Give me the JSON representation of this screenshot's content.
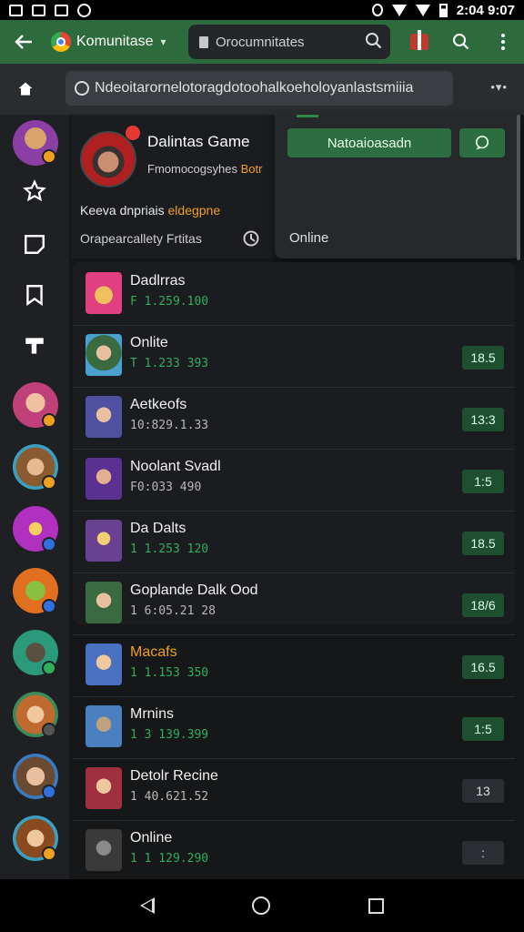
{
  "status_bar": {
    "time": "2:04 9:07"
  },
  "toolbar": {
    "tab_title": "Komunitase",
    "url_title": "Orocumnitates"
  },
  "address": {
    "text": "Ndeoitarornelotoragdotoohalkoeholoyanlastsmiiia",
    "more": "•▾•"
  },
  "profile": {
    "name": "Dalintas Game",
    "sub_prefix": "Fmomocogsyhes ",
    "sub_highlight": "Botr",
    "line_prefix": "Keeva dnpriais ",
    "line_highlight": "eldegpne",
    "line2": "Orapearcallety Frtitas"
  },
  "popup": {
    "primary_button": "Natoaioasadn",
    "status": "Online"
  },
  "list": {
    "items": [
      {
        "title": "Dadlrras",
        "sub": "F 1.259.100",
        "badge": ""
      },
      {
        "title": "Onlite",
        "sub": "T 1.233 393",
        "badge": "18.5"
      },
      {
        "title": "Aetkeofs",
        "sub": "10:829.1.33",
        "badge": "13:3"
      },
      {
        "title": "Noolant Svadl",
        "sub": "F0:033 490",
        "badge": "1:5"
      },
      {
        "title": "Da Dalts",
        "sub": "1 1.253 120",
        "badge": "18.5"
      },
      {
        "title": "Goplande Dalk Ood",
        "sub": "1 6:05.21 28",
        "badge": "18/6"
      },
      {
        "title": "Macafs",
        "sub": "1 1.153 350",
        "badge": "16.5"
      },
      {
        "title": "Mrnins",
        "sub": "1 3 139.399",
        "badge": "1:5"
      },
      {
        "title": "Detolr Recine",
        "sub": "1 40.621.52",
        "badge": "13"
      },
      {
        "title": "Online",
        "sub": "1 1 129.290",
        "badge": ":"
      }
    ]
  },
  "colors": {
    "accent": "#2d6b3c",
    "badge": "#1f4f31",
    "highlight": "#f0a020",
    "online": "#2fae5e"
  }
}
